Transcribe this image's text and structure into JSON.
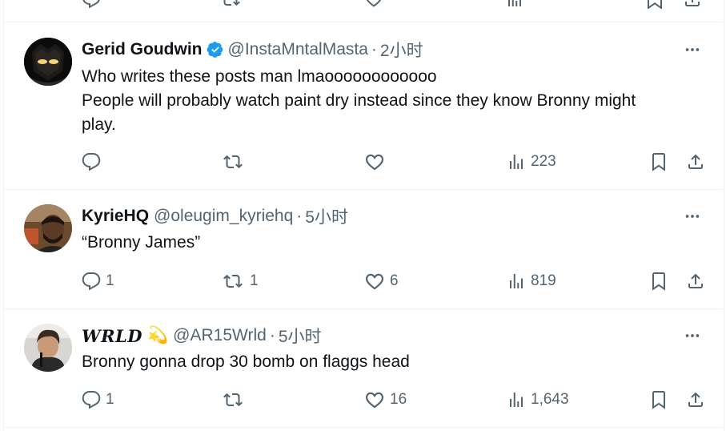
{
  "tweets": [
    {
      "name": "Gerid Goudwin",
      "verified": true,
      "handle": "@InstaMntalMasta",
      "time": "2小时",
      "lines": [
        "Who writes these posts man lmaoooooooooooo",
        "People will probably watch paint dry instead since they know Bronny might",
        "play."
      ],
      "replies": "",
      "reposts": "",
      "likes": "",
      "views": "223"
    },
    {
      "name": "KyrieHQ",
      "verified": false,
      "handle": "@oleugim_kyriehq",
      "time": "5小时",
      "lines": [
        "“Bronny James”"
      ],
      "replies": "1",
      "reposts": "1",
      "likes": "6",
      "views": "819"
    },
    {
      "name": "WRLD",
      "name_emoji": "💫",
      "verified": false,
      "handle": "@AR15Wrld",
      "time": "5小时",
      "lines": [
        "Bronny gonna drop 30 bomb on flaggs head"
      ],
      "replies": "1",
      "reposts": "",
      "likes": "16",
      "views": "1,643"
    }
  ],
  "colors": {
    "text": "#0f1419",
    "secondary": "#536471",
    "verified": "#1d9bf0",
    "divider": "#eff3f4"
  },
  "icons": [
    "reply-icon",
    "repost-icon",
    "like-icon",
    "views-icon",
    "bookmark-icon",
    "share-icon",
    "more-icon",
    "verified-badge-icon"
  ]
}
